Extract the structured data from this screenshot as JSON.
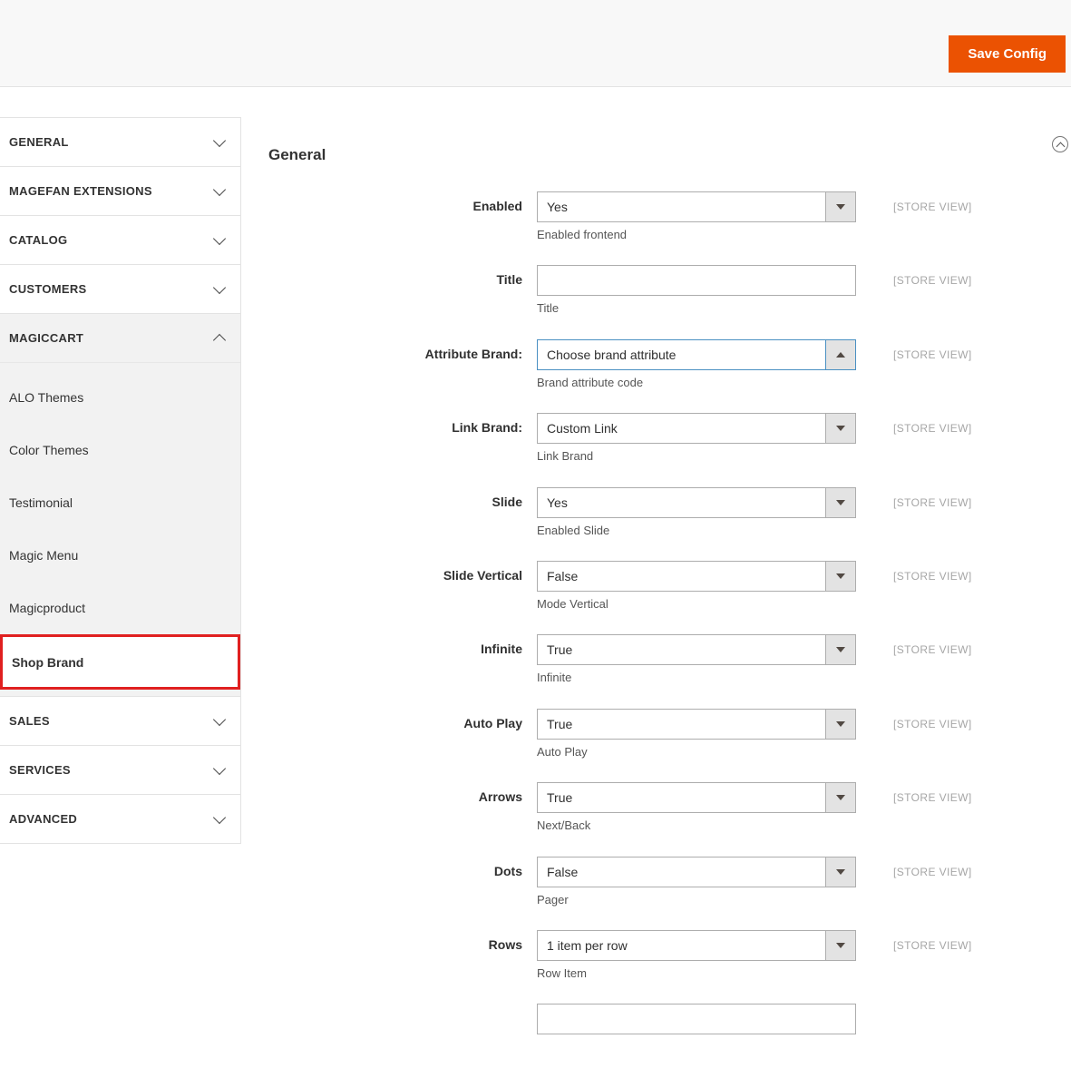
{
  "header": {
    "save_button_label": "Save Config"
  },
  "sidebar": {
    "sections": [
      {
        "label": "GENERAL",
        "chevron": "down"
      },
      {
        "label": "MAGEFAN EXTENSIONS",
        "chevron": "down"
      },
      {
        "label": "CATALOG",
        "chevron": "down"
      },
      {
        "label": "CUSTOMERS",
        "chevron": "down"
      },
      {
        "label": "MAGICCART",
        "chevron": "up",
        "expanded": true,
        "children": [
          {
            "label": "ALO Themes"
          },
          {
            "label": "Color Themes"
          },
          {
            "label": "Testimonial"
          },
          {
            "label": "Magic Menu"
          },
          {
            "label": "Magicproduct"
          },
          {
            "label": "Shop Brand",
            "active": true,
            "annotated": true
          }
        ]
      },
      {
        "label": "SALES",
        "chevron": "down"
      },
      {
        "label": "SERVICES",
        "chevron": "down"
      },
      {
        "label": "ADVANCED",
        "chevron": "down"
      }
    ]
  },
  "main": {
    "section_title": "General",
    "collapse_icon": "circled-chevron-up",
    "fields": [
      {
        "label": "Enabled",
        "type": "select",
        "value": "Yes",
        "note": "Enabled frontend",
        "scope": "[STORE VIEW]"
      },
      {
        "label": "Title",
        "type": "text",
        "value": "",
        "note": "Title",
        "scope": "[STORE VIEW]"
      },
      {
        "label": "Attribute Brand:",
        "type": "select",
        "value": "Choose brand attribute",
        "note": "Brand attribute code",
        "scope": "[STORE VIEW]",
        "focused": true,
        "open": true
      },
      {
        "label": "Link Brand:",
        "type": "select",
        "value": "Custom Link",
        "note": "Link Brand",
        "scope": "[STORE VIEW]"
      },
      {
        "label": "Slide",
        "type": "select",
        "value": "Yes",
        "note": "Enabled Slide",
        "scope": "[STORE VIEW]"
      },
      {
        "label": "Slide Vertical",
        "type": "select",
        "value": "False",
        "note": "Mode Vertical",
        "scope": "[STORE VIEW]"
      },
      {
        "label": "Infinite",
        "type": "select",
        "value": "True",
        "note": "Infinite",
        "scope": "[STORE VIEW]"
      },
      {
        "label": "Auto Play",
        "type": "select",
        "value": "True",
        "note": "Auto Play",
        "scope": "[STORE VIEW]"
      },
      {
        "label": "Arrows",
        "type": "select",
        "value": "True",
        "note": "Next/Back",
        "scope": "[STORE VIEW]"
      },
      {
        "label": "Dots",
        "type": "select",
        "value": "False",
        "note": "Pager",
        "scope": "[STORE VIEW]"
      },
      {
        "label": "Rows",
        "type": "select",
        "value": "1 item per row",
        "note": "Row Item",
        "scope": "[STORE VIEW]"
      },
      {
        "label": "",
        "type": "text",
        "value": "",
        "note": "",
        "scope": "",
        "partial": true
      }
    ]
  },
  "colors": {
    "accent_orange": "#eb5202",
    "annotation_red": "#e02020",
    "focus_blue": "#4a90c2",
    "header_background": "#f8f8f8",
    "expanded_section_background": "#f2f2f2",
    "scope_text": "#a6a6a6",
    "field_border": "#adadad"
  }
}
